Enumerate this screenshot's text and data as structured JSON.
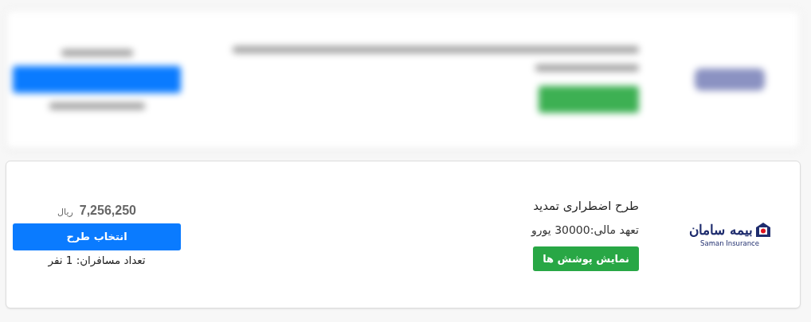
{
  "plans": [
    {
      "blurred": true
    },
    {
      "blurred": false,
      "logo": {
        "name": "بیمه سامان",
        "caption": "Saman Insurance"
      },
      "title": "طرح اضطراری تمدید",
      "coverage": "تعهد مالی:30000 یورو",
      "details_button": "نمایش پوشش ها",
      "price": "7,256,250",
      "currency": "ریال",
      "select_button": "انتخاب طرح",
      "travelers": "تعداد مسافران: 1 نفر"
    }
  ]
}
